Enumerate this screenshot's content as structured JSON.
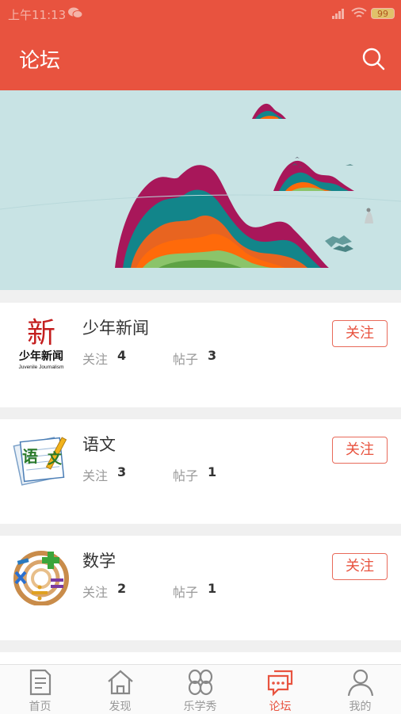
{
  "status": {
    "time": "上午11:13",
    "battery": "99"
  },
  "header": {
    "title": "论坛"
  },
  "forums": [
    {
      "name": "少年新闻",
      "follow_label": "关注",
      "follow_count": "4",
      "posts_label": "帖子",
      "posts_count": "3",
      "button": "关注",
      "logo_char": "新",
      "logo_text": "少年新闻",
      "logo_sub": "Juvenile Journalism"
    },
    {
      "name": "语文",
      "follow_label": "关注",
      "follow_count": "3",
      "posts_label": "帖子",
      "posts_count": "1",
      "button": "关注",
      "logo_chars": [
        "语",
        "文"
      ]
    },
    {
      "name": "数学",
      "follow_label": "关注",
      "follow_count": "2",
      "posts_label": "帖子",
      "posts_count": "1",
      "button": "关注"
    }
  ],
  "tabs": [
    {
      "label": "首页",
      "icon": "document-icon"
    },
    {
      "label": "发现",
      "icon": "home-icon"
    },
    {
      "label": "乐学秀",
      "icon": "clover-icon"
    },
    {
      "label": "论坛",
      "icon": "chat-icon",
      "active": true
    },
    {
      "label": "我的",
      "icon": "person-icon"
    }
  ],
  "colors": {
    "primary": "#e8533f",
    "banner_bg": "#c8e3e4"
  }
}
